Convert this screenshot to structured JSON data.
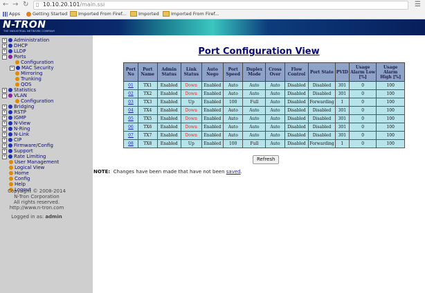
{
  "browser": {
    "url_host": "10.10.20.101",
    "url_path": "/main.ssi",
    "bookmarks": [
      "Apps",
      "Getting Started",
      "Imported From Firef...",
      "Imported",
      "Imported From Firef..."
    ]
  },
  "banner": {
    "logo": "N-TRON",
    "tagline": "THE INDUSTRIAL NETWORK COMPANY"
  },
  "sidebar": {
    "items": [
      {
        "label": "Administration",
        "type": "folder"
      },
      {
        "label": "DHCP",
        "type": "folder"
      },
      {
        "label": "LLDP",
        "type": "folder"
      },
      {
        "label": "Ports",
        "type": "folder-open"
      },
      {
        "label": "Configuration",
        "type": "leaf"
      },
      {
        "label": "MAC Security",
        "type": "sub-folder"
      },
      {
        "label": "Mirroring",
        "type": "leaf"
      },
      {
        "label": "Trunking",
        "type": "leaf"
      },
      {
        "label": "QOS",
        "type": "leaf"
      },
      {
        "label": "Statistics",
        "type": "folder"
      },
      {
        "label": "VLAN",
        "type": "folder-open"
      },
      {
        "label": "Configuration",
        "type": "leaf"
      },
      {
        "label": "Bridging",
        "type": "folder"
      },
      {
        "label": "RSTP",
        "type": "folder"
      },
      {
        "label": "IGMP",
        "type": "folder"
      },
      {
        "label": "N-View",
        "type": "folder"
      },
      {
        "label": "N-Ring",
        "type": "folder"
      },
      {
        "label": "N-Link",
        "type": "folder"
      },
      {
        "label": "CIP",
        "type": "folder"
      },
      {
        "label": "Firmware/Config",
        "type": "folder"
      },
      {
        "label": "Support",
        "type": "folder"
      },
      {
        "label": "Rate Limiting",
        "type": "folder"
      },
      {
        "label": "User Management",
        "type": "link"
      },
      {
        "label": "Logical View",
        "type": "link"
      },
      {
        "label": "Home",
        "type": "link"
      },
      {
        "label": "Config",
        "type": "link"
      },
      {
        "label": "Help",
        "type": "link"
      },
      {
        "label": "Logout",
        "type": "link"
      }
    ],
    "copyright": "Copyright © 2008-2014",
    "company": "N-Tron Corporation",
    "rights": "All rights reserved.",
    "website": "http://www.n-tron.com",
    "logged_in_label": "Logged in as:",
    "logged_in_user": "admin"
  },
  "main": {
    "title": "Port Configuration View",
    "headers": [
      "Port No",
      "Port Name",
      "Admin Status",
      "Link Status",
      "Auto Nego",
      "Port Speed",
      "Duplex Mode",
      "Cross Over",
      "Flow Control",
      "Port State",
      "PVID",
      "Usage Alarm Low [%]",
      "Usage Alarm High [%]"
    ],
    "rows": [
      [
        "01",
        "TX1",
        "Enabled",
        "Down",
        "Enabled",
        "Auto",
        "Auto",
        "Auto",
        "Disabled",
        "Disabled",
        "301",
        "0",
        "100"
      ],
      [
        "02",
        "TX2",
        "Enabled",
        "Down",
        "Enabled",
        "Auto",
        "Auto",
        "Auto",
        "Disabled",
        "Disabled",
        "301",
        "0",
        "100"
      ],
      [
        "03",
        "TX3",
        "Enabled",
        "Up",
        "Enabled",
        "100",
        "Full",
        "Auto",
        "Disabled",
        "Forwarding",
        "1",
        "0",
        "100"
      ],
      [
        "04",
        "TX4",
        "Enabled",
        "Down",
        "Enabled",
        "Auto",
        "Auto",
        "Auto",
        "Disabled",
        "Disabled",
        "301",
        "0",
        "100"
      ],
      [
        "05",
        "TX5",
        "Enabled",
        "Down",
        "Enabled",
        "Auto",
        "Auto",
        "Auto",
        "Disabled",
        "Disabled",
        "301",
        "0",
        "100"
      ],
      [
        "06",
        "TX6",
        "Enabled",
        "Down",
        "Enabled",
        "Auto",
        "Auto",
        "Auto",
        "Disabled",
        "Disabled",
        "301",
        "0",
        "100"
      ],
      [
        "07",
        "TX7",
        "Enabled",
        "Down",
        "Enabled",
        "Auto",
        "Auto",
        "Auto",
        "Disabled",
        "Disabled",
        "301",
        "0",
        "100"
      ],
      [
        "08",
        "TX8",
        "Enabled",
        "Up",
        "Enabled",
        "100",
        "Full",
        "Auto",
        "Disabled",
        "Forwarding",
        "1",
        "0",
        "100"
      ]
    ],
    "refresh_label": "Refresh",
    "note_label": "NOTE:",
    "note_text": "Changes have been made that have not been",
    "note_link": "saved",
    "note_end": "."
  },
  "colors": {
    "link_down": "#e0201c",
    "header_bg": "#8fa3c8",
    "cell_bg": "#b7e4ea",
    "sidebar_bg": "#cfcfcf"
  }
}
